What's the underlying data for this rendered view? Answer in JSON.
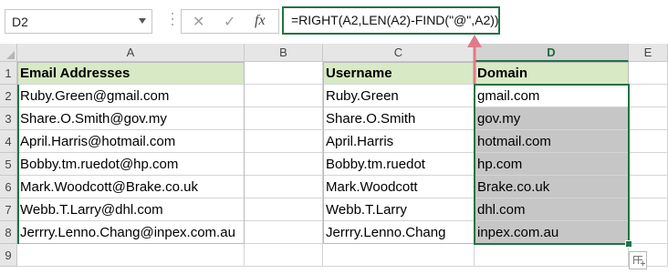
{
  "formula_bar": {
    "name_box": "D2",
    "cancel_icon": "✕",
    "enter_icon": "✓",
    "fx_label": "fx",
    "formula": "=RIGHT(A2,LEN(A2)-FIND(\"@\",A2))"
  },
  "columns": [
    "A",
    "B",
    "C",
    "D",
    "E"
  ],
  "rows": [
    "1",
    "2",
    "3",
    "4",
    "5",
    "6",
    "7",
    "8",
    "9"
  ],
  "headers": {
    "A": "Email Addresses",
    "C": "Username",
    "D": "Domain"
  },
  "emails": [
    "Ruby.Green@gmail.com",
    "Share.O.Smith@gov.my",
    "April.Harris@hotmail.com",
    "Bobby.tm.ruedot@hp.com",
    "Mark.Woodcott@Brake.co.uk",
    "Webb.T.Larry@dhl.com",
    "Jerrry.Lenno.Chang@inpex.com.au"
  ],
  "usernames": [
    "Ruby.Green",
    "Share.O.Smith",
    "April.Harris",
    "Bobby.tm.ruedot",
    "Mark.Woodcott",
    "Webb.T.Larry",
    "Jerrry.Lenno.Chang"
  ],
  "domains": [
    "gmail.com",
    "gov.my",
    "hotmail.com",
    "hp.com",
    "Brake.co.uk",
    "dhl.com",
    "inpex.com.au"
  ],
  "colors": {
    "header_fill": "#d8e9c5",
    "selection_border": "#217346",
    "selection_fill": "#c6c6c6",
    "arrow": "#e07a8a"
  }
}
